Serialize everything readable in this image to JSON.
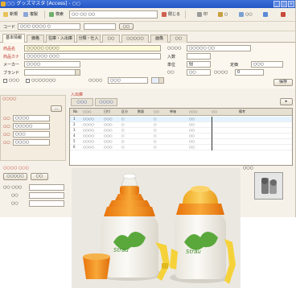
{
  "window": {
    "title": "○○ グッズマスタ [Access] - ○○"
  },
  "toolbar": {
    "btn1": "新規",
    "btn2": "複製",
    "btn3": "検索",
    "btn4": "閉じる",
    "search_value": "○○ ○○ ○○",
    "right1": "印",
    "right2": "○",
    "right3": "○○"
  },
  "row2": {
    "code_label": "コード",
    "code_value": "○○○ ○○○○ ○",
    "name_value": "",
    "btn": "○○"
  },
  "tabs": [
    "基本情報",
    "価格",
    "在庫・入出庫",
    "分類・仕入",
    "○○",
    "○○○○○",
    "画像",
    "○○"
  ],
  "form": {
    "f1_label": "商品名",
    "f1_value": "○○○○○ ○○○○",
    "f2_label": "商品カナ",
    "f2_value": "○○○○○○ ○○○",
    "f3_label": "メーカー",
    "f3_value": "○○○○",
    "f4_label": "ブランド",
    "f4_value": "",
    "f5_label": "サイズ",
    "f5_value": "",
    "chk1": "○○○",
    "chk2": "○○○○○○○",
    "f6_label": "○○○○",
    "f6_value": "○○○",
    "r1_label": "○○○○",
    "r1_value": "○○○○○ ○○",
    "r2_label": "入数",
    "r2_value": "",
    "r3_label": "単位",
    "r3_value": "個",
    "r4_label": "定価",
    "r4_value": "○○○",
    "r5_label": "○○",
    "r5_value": "○○",
    "r6_label": "○○○○",
    "r6_value": "0",
    "btn_save": "保存"
  },
  "left_panel": {
    "title": "○○○○",
    "rows": [
      {
        "label": "○○",
        "value": "○○○○"
      },
      {
        "label": "○○",
        "value": "○○○○○"
      },
      {
        "label": "○○",
        "value": "○○○"
      },
      {
        "label": "○○",
        "value": "○○○○"
      }
    ]
  },
  "detail": {
    "label": "入出庫",
    "subtab1": "○○○",
    "subtab2": "○○○○",
    "headers": [
      "No",
      "○○○",
      "日付",
      "区分",
      "数量",
      "○○",
      "単価",
      "○○○",
      "○○",
      "備考"
    ],
    "rows": [
      {
        "c1": "1",
        "c2": "○○○○",
        "c3": "○○○",
        "c4": "○",
        "c5": "○",
        "c6": "○○"
      },
      {
        "c1": "2",
        "c2": "○○○○",
        "c3": "○○○",
        "c4": "○",
        "c5": "○",
        "c6": "○○"
      },
      {
        "c1": "3",
        "c2": "○○○○",
        "c3": "○○○",
        "c4": "○",
        "c5": "○",
        "c6": "○○"
      },
      {
        "c1": "4",
        "c2": "○○○○",
        "c3": "○○○",
        "c4": "○",
        "c5": "○",
        "c6": "○○"
      },
      {
        "c1": "5",
        "c2": "○○○○",
        "c3": "○○○",
        "c4": "○",
        "c5": "○",
        "c6": "○○"
      },
      {
        "c1": "6",
        "c2": "○○○○",
        "c3": "○○○",
        "c4": "○",
        "c5": "○",
        "c6": "○○"
      }
    ]
  },
  "bottom": {
    "title": "○○○○ ○○○",
    "btn1": "○○○○○",
    "btn2": "○○",
    "l1": "○○ ○○○",
    "l2": "○○",
    "l3": "○○",
    "photo_label": "○○○"
  },
  "colors": {
    "titlebar": "#2456c4",
    "orange": "#f08a18",
    "yellow": "#f5d23a",
    "green": "#5aa83c"
  }
}
